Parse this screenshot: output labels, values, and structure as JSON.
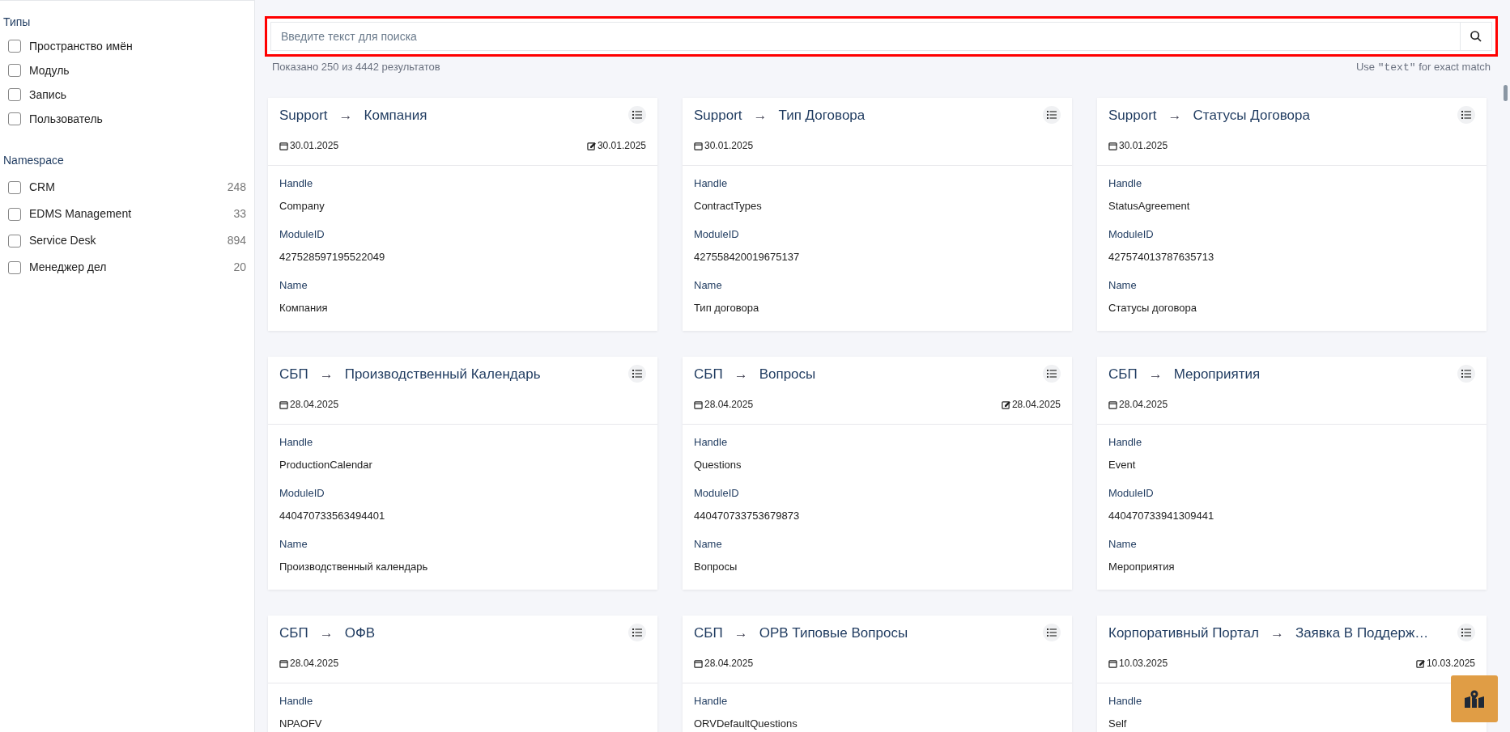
{
  "sidebar": {
    "sections": [
      {
        "title": "Типы",
        "items": [
          {
            "label": "Пространство имён",
            "checked": false
          },
          {
            "label": "Модуль",
            "checked": false
          },
          {
            "label": "Запись",
            "checked": false
          },
          {
            "label": "Пользователь",
            "checked": false
          }
        ]
      },
      {
        "title": "Namespace",
        "items": [
          {
            "label": "CRM",
            "count": "248",
            "checked": false
          },
          {
            "label": "EDMS Management",
            "count": "33",
            "checked": false
          },
          {
            "label": "Service Desk",
            "count": "894",
            "checked": false
          },
          {
            "label": "Менеджер дел",
            "count": "20",
            "checked": false
          }
        ]
      }
    ]
  },
  "search": {
    "placeholder": "Введите текст для поиска",
    "results": "Показано 250 из 4442 результатов",
    "hint_before": "Use",
    "hint_code": "\"text\"",
    "hint_after": "for exact match"
  },
  "cards": [
    {
      "namespace": "Support",
      "arrow": "→",
      "title": "Компания",
      "created": "30.01.2025",
      "updated": "30.01.2025",
      "fields": [
        {
          "label": "Handle",
          "value": "Company"
        },
        {
          "label": "ModuleID",
          "value": "427528597195522049"
        },
        {
          "label": "Name",
          "value": "Компания"
        }
      ]
    },
    {
      "namespace": "Support",
      "arrow": "→",
      "title": "Тип Договора",
      "created": "30.01.2025",
      "fields": [
        {
          "label": "Handle",
          "value": "ContractTypes"
        },
        {
          "label": "ModuleID",
          "value": "427558420019675137"
        },
        {
          "label": "Name",
          "value": "Тип договора"
        }
      ]
    },
    {
      "namespace": "Support",
      "arrow": "→",
      "title": "Статусы Договора",
      "created": "30.01.2025",
      "fields": [
        {
          "label": "Handle",
          "value": "StatusAgreement"
        },
        {
          "label": "ModuleID",
          "value": "427574013787635713"
        },
        {
          "label": "Name",
          "value": "Статусы договора"
        }
      ]
    },
    {
      "namespace": "СБП",
      "arrow": "→",
      "title": "Производственный Календарь",
      "created": "28.04.2025",
      "fields": [
        {
          "label": "Handle",
          "value": "ProductionCalendar"
        },
        {
          "label": "ModuleID",
          "value": "440470733563494401"
        },
        {
          "label": "Name",
          "value": "Производственный календарь"
        }
      ]
    },
    {
      "namespace": "СБП",
      "arrow": "→",
      "title": "Вопросы",
      "created": "28.04.2025",
      "updated": "28.04.2025",
      "fields": [
        {
          "label": "Handle",
          "value": "Questions"
        },
        {
          "label": "ModuleID",
          "value": "440470733753679873"
        },
        {
          "label": "Name",
          "value": "Вопросы"
        }
      ]
    },
    {
      "namespace": "СБП",
      "arrow": "→",
      "title": "Мероприятия",
      "created": "28.04.2025",
      "fields": [
        {
          "label": "Handle",
          "value": "Event"
        },
        {
          "label": "ModuleID",
          "value": "440470733941309441"
        },
        {
          "label": "Name",
          "value": "Мероприятия"
        }
      ]
    },
    {
      "namespace": "СБП",
      "arrow": "→",
      "title": "ОФВ",
      "created": "28.04.2025",
      "fields": [
        {
          "label": "Handle",
          "value": "NPAOFV"
        }
      ]
    },
    {
      "namespace": "СБП",
      "arrow": "→",
      "title": "ОРВ Типовые Вопросы",
      "created": "28.04.2025",
      "fields": [
        {
          "label": "Handle",
          "value": "ORVDefaultQuestions"
        }
      ]
    },
    {
      "namespace": "Корпоративный Портал",
      "arrow": "→",
      "title": "Заявка В Поддерж…",
      "created": "10.03.2025",
      "updated": "10.03.2025",
      "fields": [
        {
          "label": "Handle",
          "value": "Self"
        }
      ]
    }
  ]
}
